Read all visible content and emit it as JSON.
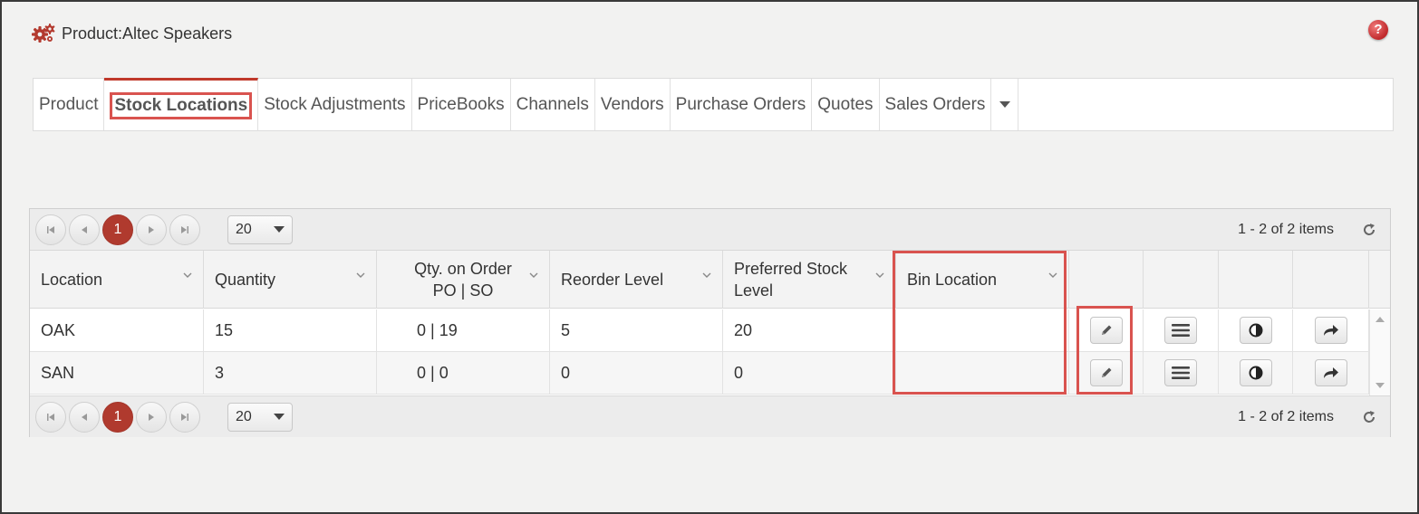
{
  "header": {
    "title": "Product:Altec Speakers",
    "help_label": "?"
  },
  "tabs": [
    {
      "label": "Product"
    },
    {
      "label": "Stock Locations",
      "active": true
    },
    {
      "label": "Stock Adjustments"
    },
    {
      "label": "PriceBooks"
    },
    {
      "label": "Channels"
    },
    {
      "label": "Vendors"
    },
    {
      "label": "Purchase Orders"
    },
    {
      "label": "Quotes"
    },
    {
      "label": "Sales Orders"
    }
  ],
  "pager": {
    "current_page": "1",
    "page_size": "20",
    "info": "1 - 2 of 2 items"
  },
  "table": {
    "columns": [
      {
        "label": "Location"
      },
      {
        "label": "Quantity"
      },
      {
        "label": "Qty. on Order\nPO | SO"
      },
      {
        "label": "Reorder Level"
      },
      {
        "label": "Preferred Stock\nLevel"
      },
      {
        "label": "Bin Location"
      }
    ],
    "rows": [
      {
        "location": "OAK",
        "quantity": "15",
        "qty_on_order": "0 | 19",
        "reorder_level": "5",
        "preferred_stock_level": "20",
        "bin_location": ""
      },
      {
        "location": "SAN",
        "quantity": "3",
        "qty_on_order": "0 | 0",
        "reorder_level": "0",
        "preferred_stock_level": "0",
        "bin_location": ""
      }
    ]
  },
  "colors": {
    "accent": "#b03a2e",
    "highlight": "#d9534f"
  },
  "icons": {
    "header": "gears-icon",
    "help": "help-icon",
    "row_actions": [
      "pencil-icon",
      "menu-icon",
      "contrast-icon",
      "share-icon"
    ],
    "refresh": "refresh-icon"
  }
}
